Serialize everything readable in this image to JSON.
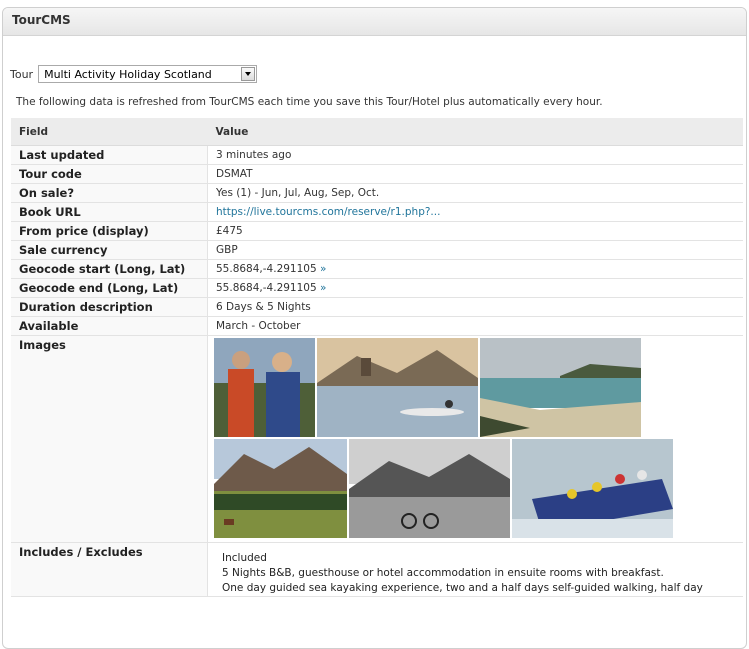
{
  "panel": {
    "title": "TourCMS"
  },
  "tour": {
    "label": "Tour",
    "selected": "Multi Activity Holiday Scotland"
  },
  "info_text": "The following data is refreshed from TourCMS each time you save this Tour/Hotel plus automatically every hour.",
  "table": {
    "headers": [
      "Field",
      "Value"
    ],
    "rows": [
      {
        "field": "Last updated",
        "value": "3 minutes ago"
      },
      {
        "field": "Tour code",
        "value": "DSMAT"
      },
      {
        "field": "On sale?",
        "value": "Yes (1) - Jun, Jul, Aug, Sep, Oct."
      },
      {
        "field": "Book URL",
        "value": "https://live.tourcms.com/reserve/r1.php?..."
      },
      {
        "field": "From price (display)",
        "value": "£475"
      },
      {
        "field": "Sale currency",
        "value": "GBP"
      },
      {
        "field": "Geocode start (Long, Lat)",
        "value": "55.8684,-4.291105",
        "link": "»"
      },
      {
        "field": "Geocode end (Long, Lat)",
        "value": "55.8684,-4.291105",
        "link": "»"
      },
      {
        "field": "Duration description",
        "value": "6 Days & 5 Nights"
      },
      {
        "field": "Available",
        "value": "March - October"
      }
    ],
    "images_label": "Images",
    "includes_label": "Includes / Excludes",
    "includes": {
      "heading": "Included",
      "lines": [
        "5 Nights B&B, guesthouse or hotel accommodation in ensuite rooms with breakfast.",
        "One day guided sea kayaking experience, two and a half days self-guided walking, half day"
      ]
    }
  },
  "colors": {
    "link": "#21759b",
    "header_bg": "#ececec"
  }
}
